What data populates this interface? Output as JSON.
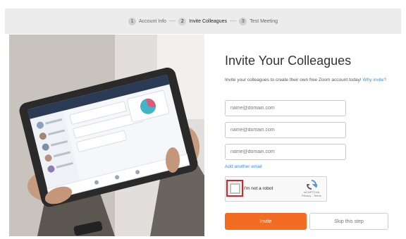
{
  "steps": [
    {
      "num": "1",
      "label": "Account Info"
    },
    {
      "num": "2",
      "label": "Invite Colleagues"
    },
    {
      "num": "3",
      "label": "Test Meeting"
    }
  ],
  "step_separator": "----",
  "invite": {
    "title": "Invite Your Colleagues",
    "subtitle": "Invite your colleagues to create their own free Zoom account today!",
    "why_link": "Why invite?",
    "email_placeholder": "name@domain.com",
    "add_link": "Add another email"
  },
  "captcha": {
    "label": "I'm not a robot",
    "brand": "reCAPTCHA",
    "terms": "Privacy - Terms"
  },
  "buttons": {
    "invite": "Invite",
    "skip": "Skip this step"
  },
  "colors": {
    "accent": "#f26d21",
    "link": "#2d8cff",
    "highlight": "#d6232a"
  }
}
